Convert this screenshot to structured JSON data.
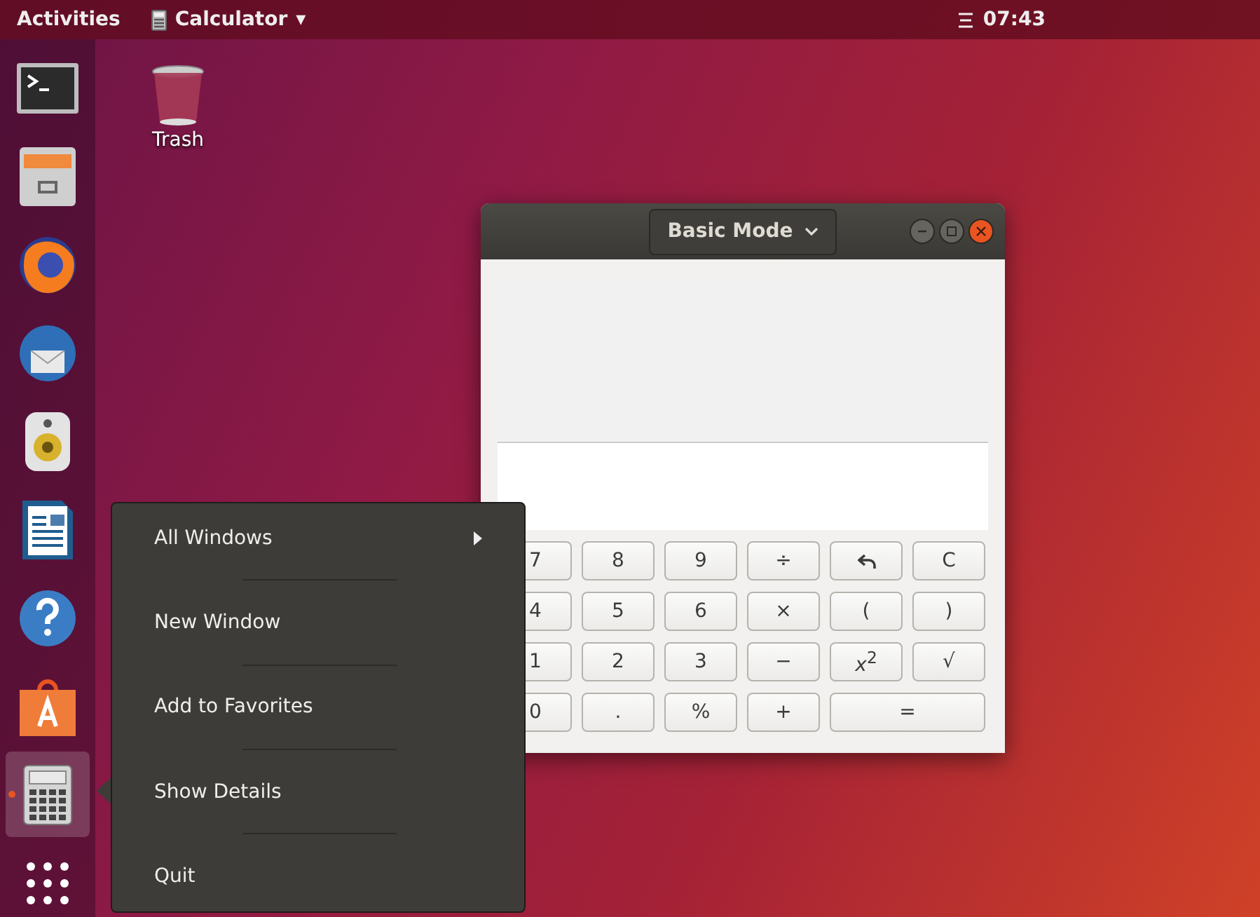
{
  "top_bar": {
    "activities": "Activities",
    "app_menu": {
      "label": "Calculator",
      "caret": "▾"
    },
    "clock": "07:43"
  },
  "dock": {
    "items": [
      {
        "kind": "terminal",
        "selected": false,
        "running": false
      },
      {
        "kind": "files",
        "selected": false,
        "running": false
      },
      {
        "kind": "browser",
        "selected": false,
        "running": false
      },
      {
        "kind": "mail",
        "selected": false,
        "running": false
      },
      {
        "kind": "music",
        "selected": false,
        "running": false
      },
      {
        "kind": "writer",
        "selected": false,
        "running": false
      },
      {
        "kind": "help",
        "selected": false,
        "running": false
      },
      {
        "kind": "software",
        "selected": false,
        "running": false
      },
      {
        "kind": "calculator",
        "selected": true,
        "running": true
      }
    ]
  },
  "desktop_icons": [
    {
      "label": "Trash"
    }
  ],
  "calculator_window": {
    "mode_button": "Basic Mode",
    "keys": [
      {
        "kind": "text",
        "label": "7"
      },
      {
        "kind": "text",
        "label": "8"
      },
      {
        "kind": "text",
        "label": "9"
      },
      {
        "kind": "text",
        "label": "÷"
      },
      {
        "kind": "backspace"
      },
      {
        "kind": "text",
        "label": "C"
      },
      {
        "kind": "text",
        "label": "4"
      },
      {
        "kind": "text",
        "label": "5"
      },
      {
        "kind": "text",
        "label": "6"
      },
      {
        "kind": "text",
        "label": "×"
      },
      {
        "kind": "text",
        "label": "("
      },
      {
        "kind": "text",
        "label": ")"
      },
      {
        "kind": "text",
        "label": "1"
      },
      {
        "kind": "text",
        "label": "2"
      },
      {
        "kind": "text",
        "label": "3"
      },
      {
        "kind": "text",
        "label": "−"
      },
      {
        "kind": "text",
        "label": "*x*$^{2}$"
      },
      {
        "kind": "text",
        "label": "√"
      },
      {
        "kind": "text",
        "label": "0"
      },
      {
        "kind": "text",
        "label": "."
      },
      {
        "kind": "text",
        "label": "%"
      },
      {
        "kind": "text",
        "label": "+"
      },
      {
        "kind": "wide",
        "label": "="
      }
    ]
  },
  "context_menu": {
    "items": [
      {
        "label": "All Windows",
        "has_submenu": true
      },
      {
        "label": "New Window",
        "has_submenu": false
      },
      {
        "label": "Add to Favorites",
        "has_submenu": false
      },
      {
        "label": "Show Details",
        "has_submenu": false
      },
      {
        "label": "Quit",
        "has_submenu": false
      }
    ]
  }
}
